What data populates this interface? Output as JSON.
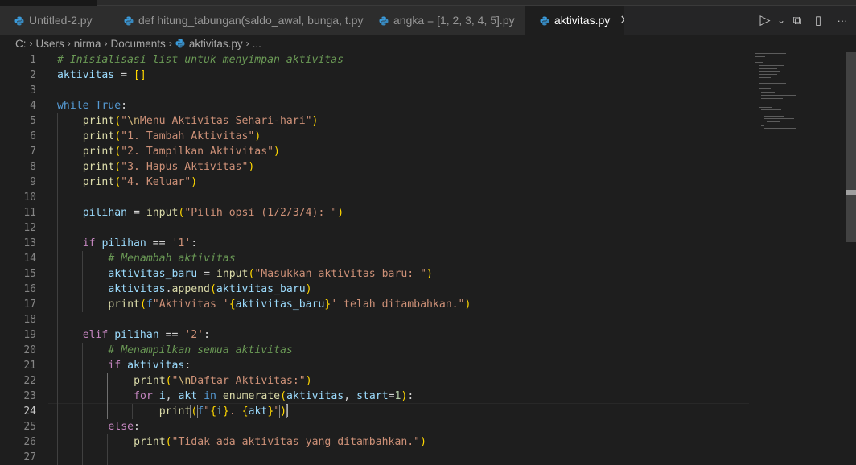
{
  "tabs": [
    {
      "label": "Untitled-2.py",
      "active": false,
      "icon": "python-file-icon"
    },
    {
      "label": "def hitung_tabungan(saldo_awal, bunga, t.py",
      "active": false,
      "icon": "python-file-icon"
    },
    {
      "label": "angka = [1, 2, 3, 4, 5].py",
      "active": false,
      "icon": "python-file-icon"
    },
    {
      "label": "aktivitas.py",
      "active": true,
      "icon": "python-file-icon",
      "close": "✕"
    }
  ],
  "actions": {
    "run": "▷",
    "run_menu": "⌄",
    "split_alt": "⧉",
    "split": "▯",
    "more": "···"
  },
  "breadcrumb": {
    "items": [
      "C:",
      "Users",
      "nirma",
      "Documents",
      "aktivitas.py",
      "..."
    ],
    "sep": "›"
  },
  "editor": {
    "active_line": 24,
    "line_numbers": [
      "1",
      "2",
      "3",
      "4",
      "5",
      "6",
      "7",
      "8",
      "9",
      "10",
      "11",
      "12",
      "13",
      "14",
      "15",
      "16",
      "17",
      "18",
      "19",
      "20",
      "21",
      "22",
      "23",
      "24",
      "25",
      "26",
      "27"
    ],
    "lines": [
      "# Inisialisasi list untuk menyimpan aktivitas",
      "aktivitas = []",
      "",
      "while True:",
      "    print(\"\\nMenu Aktivitas Sehari-hari\")",
      "    print(\"1. Tambah Aktivitas\")",
      "    print(\"2. Tampilkan Aktivitas\")",
      "    print(\"3. Hapus Aktivitas\")",
      "    print(\"4. Keluar\")",
      "",
      "    pilihan = input(\"Pilih opsi (1/2/3/4): \")",
      "",
      "    if pilihan == '1':",
      "        # Menambah aktivitas",
      "        aktivitas_baru = input(\"Masukkan aktivitas baru: \")",
      "        aktivitas.append(aktivitas_baru)",
      "        print(f\"Aktivitas '{aktivitas_baru}' telah ditambahkan.\")",
      "",
      "    elif pilihan == '2':",
      "        # Menampilkan semua aktivitas",
      "        if aktivitas:",
      "            print(\"\\nDaftar Aktivitas:\")",
      "            for i, akt in enumerate(aktivitas, start=1):",
      "                print(f\"{i}. {akt}\")",
      "        else:",
      "            print(\"Tidak ada aktivitas yang ditambahkan.\")",
      ""
    ]
  },
  "colors": {
    "background": "#1e1e1e",
    "keyword": "#569cd6",
    "control": "#c586c0",
    "function": "#dcdcaa",
    "string": "#ce9178",
    "comment": "#6a9955",
    "number": "#b5cea8",
    "variable": "#9cdcfe",
    "bracket_1": "#ffd700",
    "bracket_2": "#da70d6",
    "python_icon": "#3b9ad9"
  }
}
